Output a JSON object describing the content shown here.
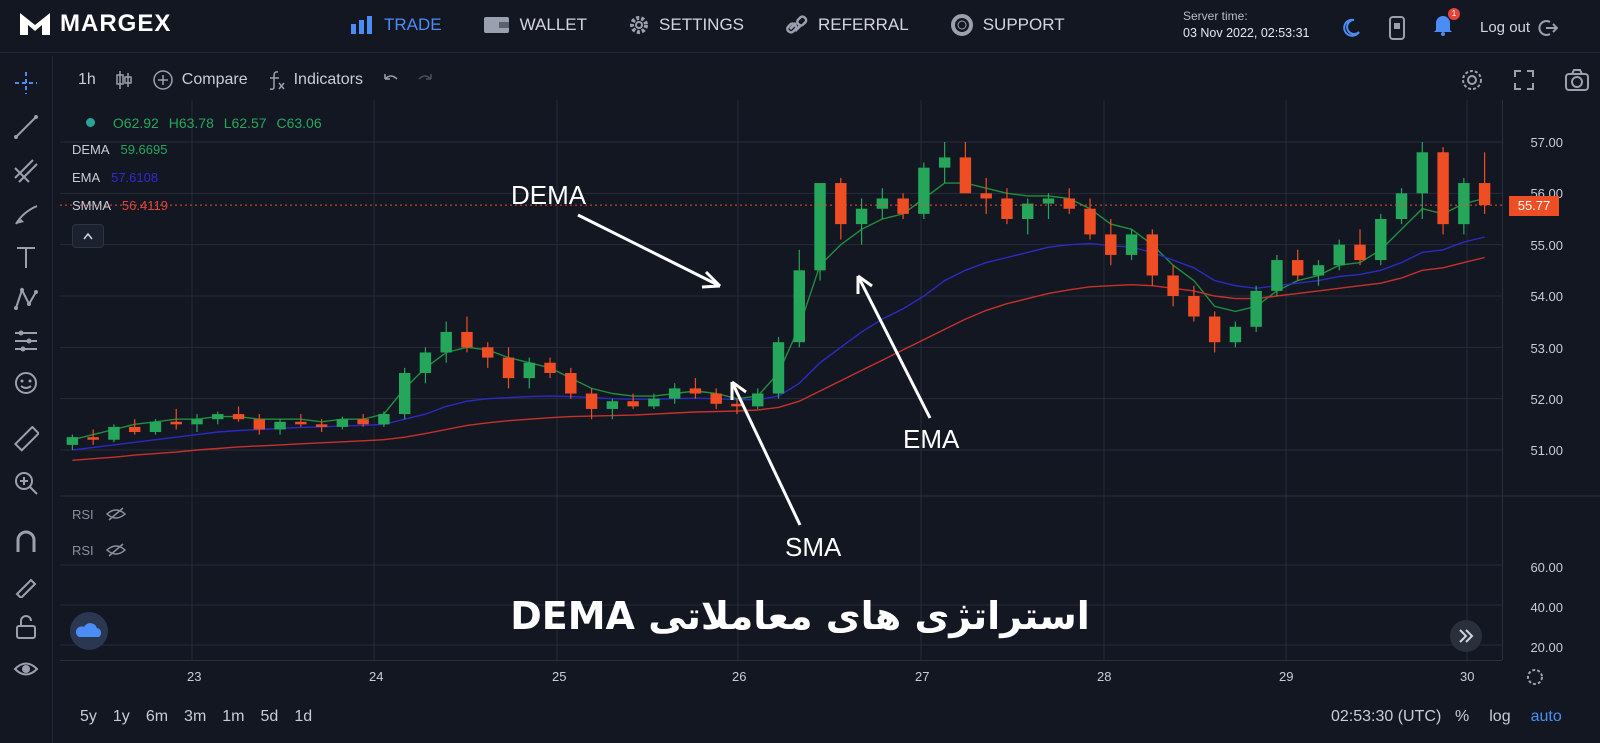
{
  "app": {
    "logo": "MARGEX"
  },
  "nav": [
    {
      "label": "TRADE",
      "icon": "bar-chart-icon",
      "active": true
    },
    {
      "label": "WALLET",
      "icon": "wallet-icon"
    },
    {
      "label": "SETTINGS",
      "icon": "gear-icon"
    },
    {
      "label": "REFERRAL",
      "icon": "link-icon"
    },
    {
      "label": "SUPPORT",
      "icon": "lifebuoy-icon"
    }
  ],
  "server": {
    "label": "Server time:",
    "time": "03 Nov 2022, 02:53:31"
  },
  "header": {
    "logout": "Log out",
    "notifications": "1"
  },
  "toolbar": {
    "interval": "1h",
    "compare": "Compare",
    "indicators": "Indicators"
  },
  "legend": {
    "o": "O62.92",
    "h": "H63.78",
    "l": "L62.57",
    "c": "C63.06",
    "indicators": [
      {
        "name": "DEMA",
        "value": "59.6695",
        "color": "#26a65b"
      },
      {
        "name": "EMA",
        "value": "57.6108",
        "color": "#2c2ccf"
      },
      {
        "name": "SMMA",
        "value": "56.4119",
        "color": "#e0443c"
      }
    ]
  },
  "rsi": [
    "RSI",
    "RSI"
  ],
  "price_axis": [
    "57.00",
    "56.00",
    "55.00",
    "54.00",
    "53.00",
    "52.00",
    "51.00"
  ],
  "current_price": "55.77",
  "rsi_axis": [
    "60.00",
    "40.00",
    "20.00"
  ],
  "time_axis": [
    "23",
    "24",
    "25",
    "26",
    "27",
    "28",
    "29",
    "30"
  ],
  "annotations": {
    "dema": "DEMA",
    "ema": "EMA",
    "sma": "SMA"
  },
  "caption": "استراتژی های معاملاتی DEMA",
  "range_buttons": [
    "5y",
    "1y",
    "6m",
    "3m",
    "1m",
    "5d",
    "1d"
  ],
  "bottom": {
    "clock": "02:53:30 (UTC)",
    "percent": "%",
    "log": "log",
    "auto": "auto"
  },
  "colors": {
    "up": "#26a65b",
    "down": "#ef4e24",
    "accent": "#4b8cf5",
    "bg": "#131722"
  },
  "chart_data": {
    "type": "candlestick",
    "ylim": [
      50.5,
      57.2
    ],
    "x": [
      "23",
      "24",
      "25",
      "26",
      "27",
      "28",
      "29",
      "30"
    ],
    "candles": [
      [
        51.1,
        51.3,
        51.0,
        51.25
      ],
      [
        51.25,
        51.4,
        51.1,
        51.2
      ],
      [
        51.2,
        51.5,
        51.15,
        51.45
      ],
      [
        51.45,
        51.6,
        51.3,
        51.35
      ],
      [
        51.35,
        51.6,
        51.3,
        51.55
      ],
      [
        51.55,
        51.8,
        51.4,
        51.5
      ],
      [
        51.5,
        51.7,
        51.35,
        51.6
      ],
      [
        51.6,
        51.75,
        51.5,
        51.7
      ],
      [
        51.7,
        51.85,
        51.55,
        51.6
      ],
      [
        51.6,
        51.7,
        51.3,
        51.4
      ],
      [
        51.4,
        51.6,
        51.3,
        51.55
      ],
      [
        51.55,
        51.7,
        51.45,
        51.5
      ],
      [
        51.5,
        51.6,
        51.35,
        51.45
      ],
      [
        51.45,
        51.65,
        51.4,
        51.6
      ],
      [
        51.6,
        51.7,
        51.45,
        51.5
      ],
      [
        51.5,
        51.75,
        51.45,
        51.7
      ],
      [
        51.7,
        52.6,
        51.6,
        52.5
      ],
      [
        52.5,
        53.0,
        52.3,
        52.9
      ],
      [
        52.9,
        53.5,
        52.7,
        53.3
      ],
      [
        53.3,
        53.6,
        52.9,
        53.0
      ],
      [
        53.0,
        53.1,
        52.6,
        52.8
      ],
      [
        52.8,
        53.0,
        52.2,
        52.4
      ],
      [
        52.4,
        52.8,
        52.2,
        52.7
      ],
      [
        52.7,
        52.8,
        52.4,
        52.5
      ],
      [
        52.5,
        52.6,
        52.0,
        52.1
      ],
      [
        52.1,
        52.2,
        51.6,
        51.8
      ],
      [
        51.8,
        52.0,
        51.6,
        51.95
      ],
      [
        51.95,
        52.1,
        51.8,
        51.85
      ],
      [
        51.85,
        52.1,
        51.8,
        52.0
      ],
      [
        52.0,
        52.3,
        51.9,
        52.2
      ],
      [
        52.2,
        52.4,
        52.0,
        52.1
      ],
      [
        52.1,
        52.2,
        51.8,
        51.9
      ],
      [
        51.9,
        52.0,
        51.7,
        51.85
      ],
      [
        51.85,
        52.2,
        51.8,
        52.1
      ],
      [
        52.1,
        53.2,
        52.0,
        53.1
      ],
      [
        53.1,
        54.9,
        53.0,
        54.5
      ],
      [
        54.5,
        56.2,
        54.3,
        56.2
      ],
      [
        56.2,
        56.3,
        55.1,
        55.4
      ],
      [
        55.4,
        55.9,
        55.0,
        55.7
      ],
      [
        55.7,
        56.1,
        55.5,
        55.9
      ],
      [
        55.9,
        56.0,
        55.5,
        55.6
      ],
      [
        55.6,
        56.6,
        55.5,
        56.5
      ],
      [
        56.5,
        57.0,
        56.2,
        56.7
      ],
      [
        56.7,
        57.0,
        56.4,
        56.0
      ],
      [
        56.0,
        56.3,
        55.6,
        55.9
      ],
      [
        55.9,
        56.1,
        55.4,
        55.5
      ],
      [
        55.5,
        55.9,
        55.2,
        55.8
      ],
      [
        55.8,
        56.0,
        55.5,
        55.9
      ],
      [
        55.9,
        56.1,
        55.6,
        55.7
      ],
      [
        55.7,
        55.9,
        55.1,
        55.2
      ],
      [
        55.2,
        55.5,
        54.6,
        54.8
      ],
      [
        54.8,
        55.3,
        54.7,
        55.2
      ],
      [
        55.2,
        55.3,
        54.2,
        54.4
      ],
      [
        54.4,
        54.6,
        53.8,
        54.0
      ],
      [
        54.0,
        54.2,
        53.5,
        53.6
      ],
      [
        53.6,
        53.7,
        52.9,
        53.1
      ],
      [
        53.1,
        53.5,
        53.0,
        53.4
      ],
      [
        53.4,
        54.2,
        53.3,
        54.1
      ],
      [
        54.1,
        54.8,
        54.0,
        54.7
      ],
      [
        54.7,
        54.9,
        54.3,
        54.4
      ],
      [
        54.4,
        54.7,
        54.2,
        54.6
      ],
      [
        54.6,
        55.1,
        54.5,
        55.0
      ],
      [
        55.0,
        55.3,
        54.6,
        54.7
      ],
      [
        54.7,
        55.6,
        54.6,
        55.5
      ],
      [
        55.5,
        56.1,
        55.4,
        56.0
      ],
      [
        56.0,
        57.0,
        55.5,
        56.8
      ],
      [
        56.8,
        56.9,
        55.2,
        55.4
      ],
      [
        55.4,
        56.3,
        55.2,
        56.2
      ],
      [
        56.2,
        56.8,
        55.6,
        55.77
      ]
    ],
    "series": [
      {
        "name": "DEMA",
        "values": [
          51.2,
          51.3,
          51.4,
          51.5,
          51.55,
          51.6,
          51.6,
          51.65,
          51.65,
          51.6,
          51.6,
          51.6,
          51.55,
          51.6,
          51.6,
          51.7,
          52.2,
          52.6,
          52.9,
          53.0,
          52.95,
          52.8,
          52.7,
          52.6,
          52.4,
          52.2,
          52.1,
          52.05,
          52.05,
          52.1,
          52.15,
          52.1,
          52.0,
          52.05,
          52.5,
          53.4,
          54.6,
          55.0,
          55.3,
          55.5,
          55.6,
          55.9,
          56.2,
          56.2,
          56.1,
          56.0,
          55.95,
          55.95,
          55.9,
          55.7,
          55.4,
          55.3,
          55.0,
          54.6,
          54.3,
          53.8,
          53.7,
          53.8,
          54.1,
          54.3,
          54.4,
          54.6,
          54.65,
          54.9,
          55.3,
          55.7,
          55.6,
          55.8,
          55.9
        ]
      },
      {
        "name": "EMA",
        "values": [
          51.0,
          51.05,
          51.1,
          51.15,
          51.2,
          51.25,
          51.3,
          51.35,
          51.38,
          51.4,
          51.42,
          51.44,
          51.45,
          51.47,
          51.48,
          51.5,
          51.6,
          51.7,
          51.85,
          51.95,
          52.0,
          52.02,
          52.04,
          52.05,
          52.04,
          52.02,
          52.0,
          51.99,
          51.99,
          52.0,
          52.01,
          52.0,
          51.98,
          51.98,
          52.05,
          52.3,
          52.7,
          53.0,
          53.3,
          53.55,
          53.75,
          54.0,
          54.3,
          54.5,
          54.65,
          54.75,
          54.85,
          54.95,
          55.0,
          55.02,
          54.98,
          54.95,
          54.85,
          54.7,
          54.55,
          54.3,
          54.2,
          54.15,
          54.2,
          54.25,
          54.3,
          54.38,
          54.42,
          54.5,
          54.65,
          54.85,
          54.9,
          55.05,
          55.15
        ]
      },
      {
        "name": "SMMA",
        "values": [
          50.8,
          50.83,
          50.86,
          50.9,
          50.93,
          50.96,
          51.0,
          51.03,
          51.06,
          51.08,
          51.1,
          51.12,
          51.14,
          51.16,
          51.18,
          51.2,
          51.25,
          51.32,
          51.4,
          51.48,
          51.53,
          51.57,
          51.6,
          51.63,
          51.65,
          51.66,
          51.67,
          51.68,
          51.7,
          51.72,
          51.74,
          51.75,
          51.76,
          51.78,
          51.83,
          51.95,
          52.15,
          52.35,
          52.55,
          52.75,
          52.95,
          53.15,
          53.35,
          53.55,
          53.72,
          53.85,
          53.95,
          54.05,
          54.12,
          54.18,
          54.2,
          54.22,
          54.2,
          54.15,
          54.1,
          54.0,
          53.95,
          53.95,
          54.0,
          54.05,
          54.1,
          54.15,
          54.2,
          54.25,
          54.35,
          54.5,
          54.55,
          54.65,
          54.75
        ]
      }
    ]
  }
}
